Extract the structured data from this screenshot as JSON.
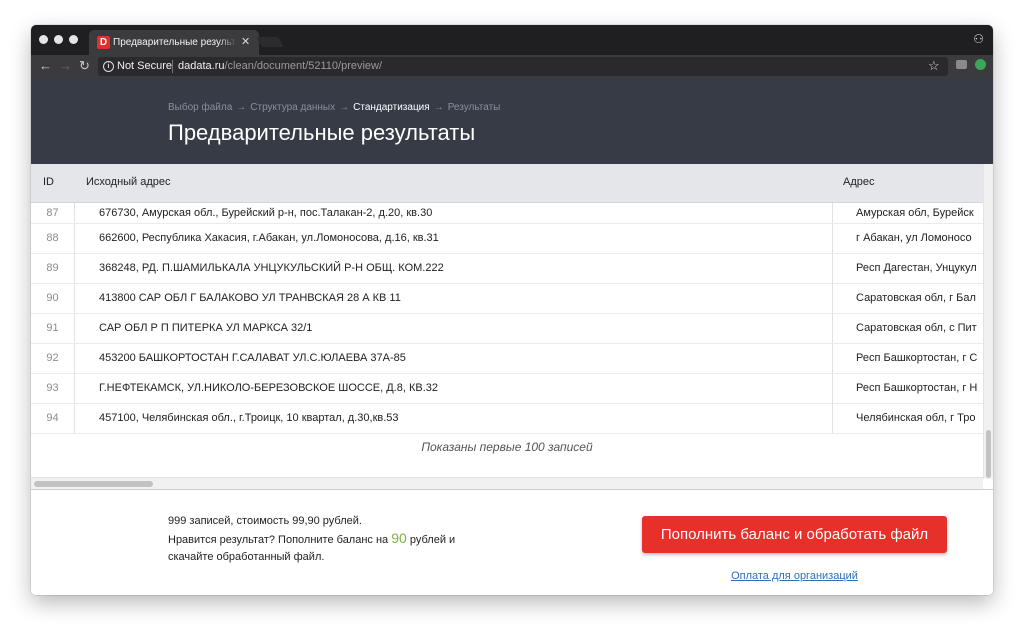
{
  "browser": {
    "tab_favicon": "D",
    "tab_title": "Предварительные результаты",
    "tab_close": "✕",
    "not_secure": "Not Secure",
    "url_domain": "dadata.ru",
    "url_path": "/clean/document/52110/preview/",
    "icons": [
      "back-icon",
      "forward-icon",
      "reload-icon",
      "info-icon",
      "star-icon",
      "incognito-icon"
    ]
  },
  "header": {
    "breadcrumb": [
      "Выбор файла",
      "Структура данных",
      "Стандартизация",
      "Результаты"
    ],
    "breadcrumb_separator": "→",
    "page_title": "Предварительные результаты"
  },
  "table": {
    "columns": {
      "id": "ID",
      "source": "Исходный адрес",
      "address": "Адрес"
    },
    "rows": [
      {
        "id": "87",
        "source": "676730, Амурская обл., Бурейский р-н, пос.Талакан-2, д.20, кв.30",
        "address": "Амурская обл, Бурейск"
      },
      {
        "id": "88",
        "source": "662600, Республика Хакасия, г.Абакан, ул.Ломоносова, д.16, кв.31",
        "address": "г Абакан, ул Ломоносо"
      },
      {
        "id": "89",
        "source": "368248, РД. П.ШАМИЛЬКАЛА УНЦУКУЛЬСКИЙ Р-Н ОБЩ. КОМ.222",
        "address": "Респ Дагестан, Унцукул"
      },
      {
        "id": "90",
        "source": "413800 САР ОБЛ Г БАЛАКОВО УЛ ТРАНВСКАЯ 28 А КВ 11",
        "address": "Саратовская обл, г Бал"
      },
      {
        "id": "91",
        "source": "САР ОБЛ Р П ПИТЕРКА УЛ МАРКСА 32/1",
        "address": "Саратовская обл, с Пит"
      },
      {
        "id": "92",
        "source": "453200 БАШКОРТОСТАН Г.САЛАВАТ УЛ.С.ЮЛАЕВА 37А-85",
        "address": "Респ Башкортостан, г С"
      },
      {
        "id": "93",
        "source": "Г.НЕФТЕКАМСК, УЛ.НИКОЛО-БЕРЕЗОВСКОЕ ШОССЕ, Д.8, КВ.32",
        "address": "Респ Башкортостан, г Н"
      },
      {
        "id": "94",
        "source": "457100, Челябинская обл., г.Троицк, 10 квартал, д.30,кв.53",
        "address": "Челябинская обл, г Тро"
      }
    ],
    "shown_note": "Показаны первые 100 записей"
  },
  "footer": {
    "line1": "999 записей, стоимость 99,90 рублей.",
    "line2_before": "Нравится результат? Пополните баланс на ",
    "price": "90",
    "line2_after": " рублей и",
    "line3": "скачайте обработанный файл.",
    "cta_label": "Пополнить баланс и обработать файл",
    "org_link": "Оплата для организаций"
  },
  "colors": {
    "header_bg": "#363b46",
    "cta": "#e8302a",
    "price": "#7cb342",
    "link": "#2f6fb5"
  }
}
